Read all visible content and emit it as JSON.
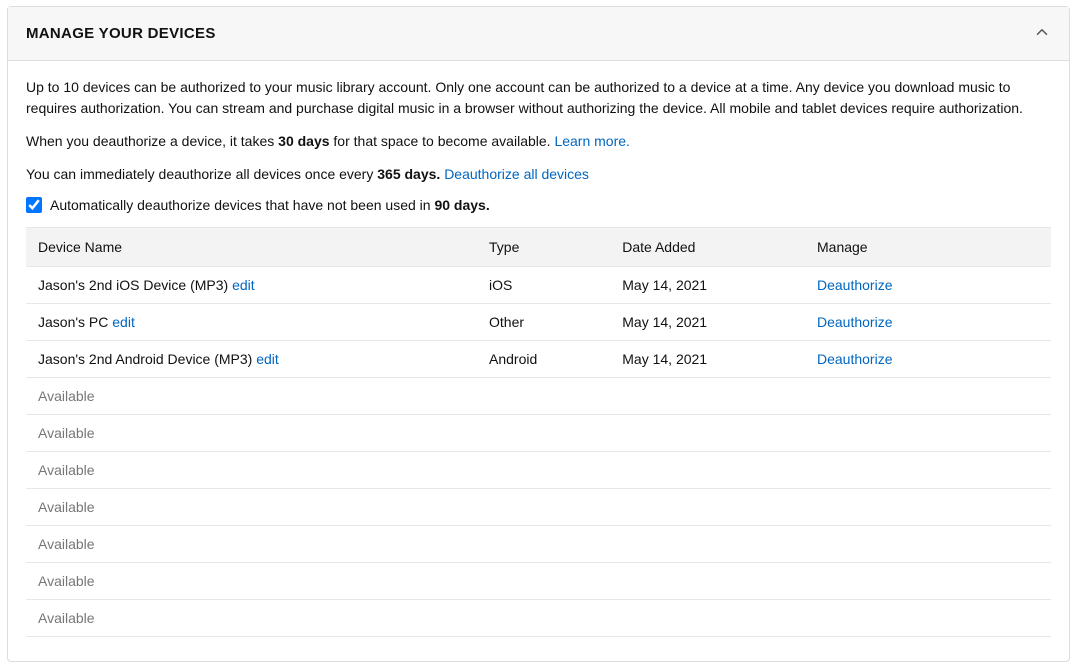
{
  "header": {
    "title": "MANAGE YOUR DEVICES"
  },
  "intro": {
    "p1": "Up to 10 devices can be authorized to your music library account. Only one account can be authorized to a device at a time. Any device you download music to requires authorization. You can stream and purchase digital music in a browser without authorizing the device. All mobile and tablet devices require authorization.",
    "p2_before": "When you deauthorize a device, it takes ",
    "p2_bold": "30 days",
    "p2_after": " for that space to become available. ",
    "learn_more": "Learn more.",
    "p3_before": "You can immediately deauthorize all devices once every ",
    "p3_bold": "365 days. ",
    "deauth_all": "Deauthorize all devices",
    "checkbox_before": "Automatically deauthorize devices that have not been used in ",
    "checkbox_bold": "90 days."
  },
  "columns": {
    "name": "Device Name",
    "type": "Type",
    "date": "Date Added",
    "manage": "Manage"
  },
  "devices": [
    {
      "name": "Jason's 2nd iOS Device (MP3)",
      "type": "iOS",
      "date": "May 14, 2021",
      "edit": "edit",
      "action": "Deauthorize"
    },
    {
      "name": "Jason's PC",
      "type": "Other",
      "date": "May 14, 2021",
      "edit": "edit",
      "action": "Deauthorize"
    },
    {
      "name": "Jason's 2nd Android Device (MP3)",
      "type": "Android",
      "date": "May 14, 2021",
      "edit": "edit",
      "action": "Deauthorize"
    }
  ],
  "available_label": "Available",
  "available_count": 7
}
